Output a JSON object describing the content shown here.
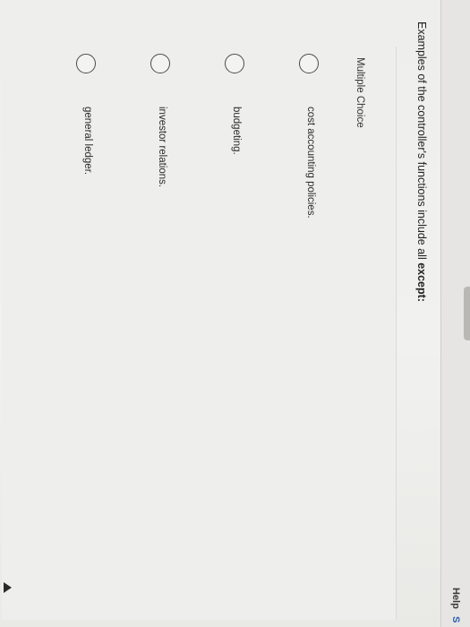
{
  "header": {
    "help_label": "Help",
    "help_partial": "S"
  },
  "question": {
    "text_prefix": "Examples of the controller's functions include all ",
    "text_emphasis": "except",
    "text_suffix": ":"
  },
  "question_type": "Multiple Choice",
  "options": [
    {
      "label": "cost accounting policies."
    },
    {
      "label": "budgeting."
    },
    {
      "label": "investor relations."
    },
    {
      "label": "general ledger."
    }
  ]
}
